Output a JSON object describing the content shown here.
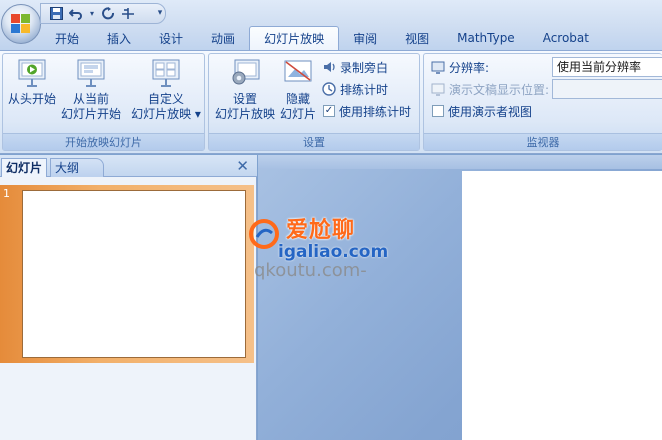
{
  "quick_access": {
    "icons": [
      "save-icon",
      "undo-icon",
      "redo-icon",
      "customize-icon"
    ],
    "more_label": "▾"
  },
  "tabs": [
    {
      "label": "开始",
      "active": false
    },
    {
      "label": "插入",
      "active": false
    },
    {
      "label": "设计",
      "active": false
    },
    {
      "label": "动画",
      "active": false
    },
    {
      "label": "幻灯片放映",
      "active": true
    },
    {
      "label": "审阅",
      "active": false
    },
    {
      "label": "视图",
      "active": false
    },
    {
      "label": "MathType",
      "active": false
    },
    {
      "label": "Acrobat",
      "active": false
    }
  ],
  "ribbon": {
    "start_show": {
      "label": "开始放映幻灯片",
      "from_beginning": {
        "line1": "从头开始",
        "line2": ""
      },
      "from_current": {
        "line1": "从当前",
        "line2": "幻灯片开始"
      },
      "custom_show": {
        "line1": "自定义",
        "line2": "幻灯片放映 ▾"
      }
    },
    "setup": {
      "label": "设置",
      "setup_show": {
        "line1": "设置",
        "line2": "幻灯片放映"
      },
      "hide_slide": {
        "line1": "隐藏",
        "line2": "幻灯片"
      },
      "record_narration": "录制旁白",
      "rehearse_timings": "排练计时",
      "use_timings": {
        "label": "使用排练计时",
        "checked": true,
        "mark": "✓"
      }
    },
    "monitors": {
      "label": "监视器",
      "resolution_label": "分辨率:",
      "resolution_value": "使用当前分辨率",
      "show_on_label": "演示文稿显示位置:",
      "show_on_value": "",
      "presenter_view": {
        "label": "使用演示者视图",
        "checked": false
      }
    }
  },
  "slides_pane": {
    "tab_slides": "幻灯片",
    "tab_outline": "大纲",
    "close_glyph": "✕",
    "thumbnails": [
      {
        "number": "1"
      }
    ]
  },
  "watermark": {
    "line1": "爱尬聊",
    "line2": "igaliao.com",
    "line3": "qkoutu.com-"
  },
  "colors": {
    "accent": "#15428b",
    "selection": "#f2b06a",
    "workspace": "#8aa9d4"
  }
}
